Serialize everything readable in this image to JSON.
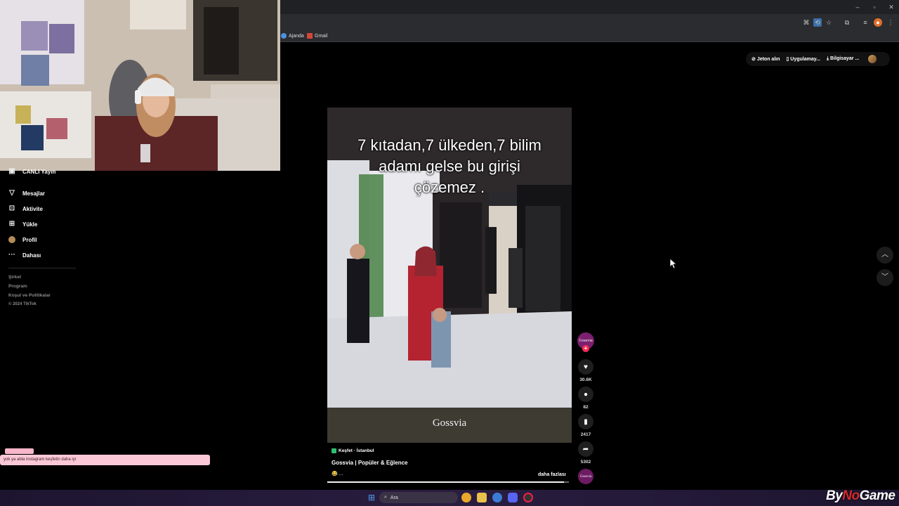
{
  "browser": {
    "bookmarks": [
      "Ajanda",
      "Gmail"
    ]
  },
  "header": {
    "coins_label": "Jeton alın",
    "app_label": "Uygulamay...",
    "pc_label": "Bilgisayar ..."
  },
  "sidebar": {
    "partial_item": "CANLI Yayın",
    "items": [
      {
        "label": "Mesajlar",
        "icon": "paper-plane-icon"
      },
      {
        "label": "Aktivite",
        "icon": "chat-box-icon"
      },
      {
        "label": "Yükle",
        "icon": "plus-square-icon"
      },
      {
        "label": "Profil",
        "icon": "avatar-icon"
      },
      {
        "label": "Dahası",
        "icon": "more-icon"
      }
    ],
    "footer": [
      "Şirket",
      "Program",
      "Koşul ve Politikalar",
      "© 2024 TikTok"
    ]
  },
  "video": {
    "caption_lines": [
      "7 kıtadan,7 ülkeden,7 bilim",
      "adamı gelse bu girişi",
      "çözemez ."
    ],
    "watermark": "Gossvia",
    "tag": "Keşfet · İstanbul",
    "title": "Gossvia | Popüler & Eğlence",
    "emoji_line": "😂 ...",
    "more_label": "daha fazlası",
    "progress": 0.98
  },
  "actions": {
    "creator_initial": "Gossvia",
    "likes": "30.6K",
    "comments": "82",
    "saves": "2417",
    "shares": "5302"
  },
  "chat": {
    "message": "yok ya abla instagram keşfetin daha iyi"
  },
  "taskbar": {
    "search_placeholder": "Ara"
  },
  "overlay": {
    "brand_prefix": "By",
    "brand_accent": "No",
    "brand_suffix": "Game"
  },
  "colors": {
    "accent": "#fe2c55",
    "chat_bg": "#fbc8d8",
    "taskbar": "#2a1d40"
  }
}
